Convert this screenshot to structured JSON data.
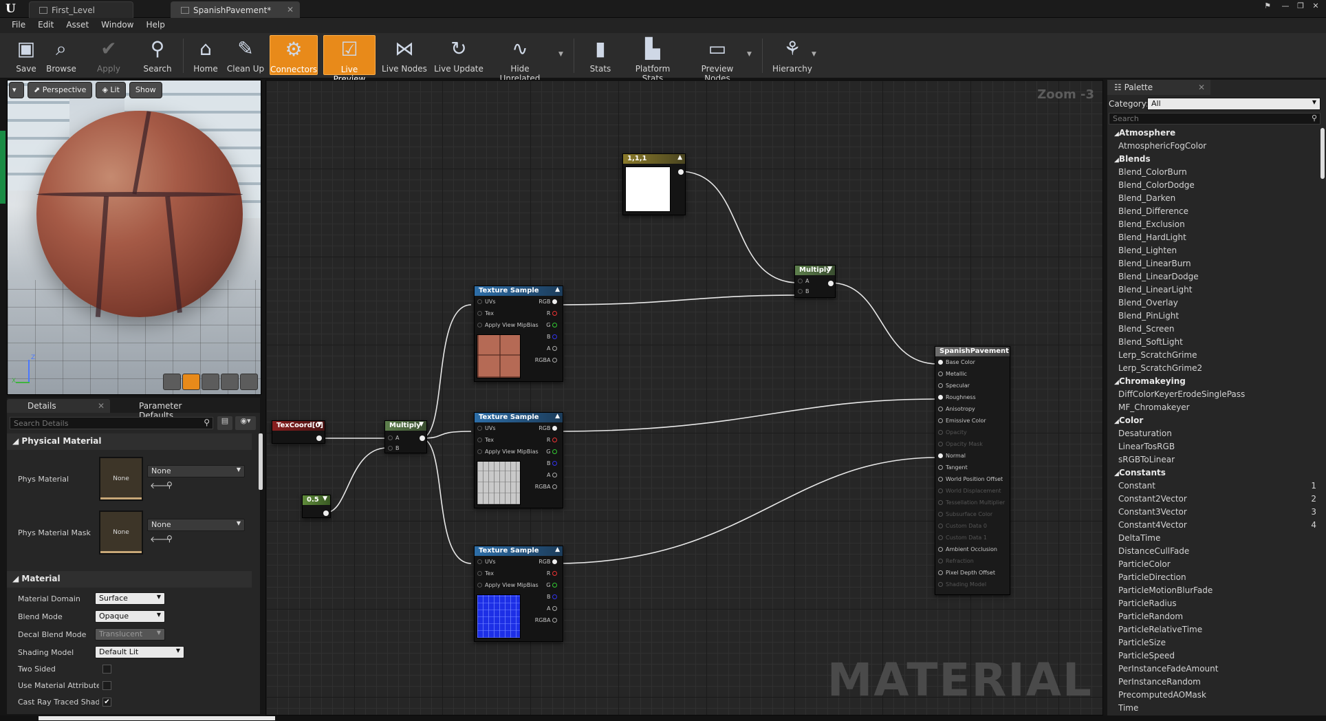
{
  "titlebar": {
    "tabs": [
      {
        "label": "First_Level"
      },
      {
        "label": "SpanishPavement*"
      }
    ]
  },
  "menu": [
    "File",
    "Edit",
    "Asset",
    "Window",
    "Help"
  ],
  "toolbar": {
    "buttons": [
      {
        "label": "Save",
        "icon": "save-icon"
      },
      {
        "label": "Browse",
        "icon": "browse-icon"
      },
      {
        "label": "Apply",
        "icon": "apply-icon",
        "disabled": true
      },
      {
        "label": "Search",
        "icon": "search-icon"
      },
      {
        "label": "Home",
        "icon": "home-icon"
      },
      {
        "label": "Clean Up",
        "icon": "cleanup-icon"
      },
      {
        "label": "Connectors",
        "icon": "connectors-icon",
        "active": true
      },
      {
        "label": "Live Preview",
        "icon": "live-preview-icon",
        "active": true
      },
      {
        "label": "Live Nodes",
        "icon": "live-nodes-icon"
      },
      {
        "label": "Live Update",
        "icon": "live-update-icon"
      },
      {
        "label": "Hide Unrelated",
        "icon": "hide-unrelated-icon"
      },
      {
        "label": "Stats",
        "icon": "stats-icon"
      },
      {
        "label": "Platform Stats",
        "icon": "platform-stats-icon"
      },
      {
        "label": "Preview Nodes",
        "icon": "preview-nodes-icon"
      },
      {
        "label": "Hierarchy",
        "icon": "hierarchy-icon"
      }
    ]
  },
  "viewport": {
    "perspective": "Perspective",
    "lit": "Lit",
    "show": "Show",
    "axis_z": "Z",
    "axis_x": "X"
  },
  "details": {
    "tabs": [
      "Details",
      "Parameter Defaults"
    ],
    "search_placeholder": "Search Details",
    "physical_material": {
      "title": "Physical Material",
      "phys_material_label": "Phys Material",
      "phys_material_value": "None",
      "phys_material_thumb": "None",
      "phys_mask_label": "Phys Material Mask",
      "phys_mask_value": "None",
      "phys_mask_thumb": "None"
    },
    "material": {
      "title": "Material",
      "rows": [
        {
          "label": "Material Domain",
          "value": "Surface"
        },
        {
          "label": "Blend Mode",
          "value": "Opaque"
        },
        {
          "label": "Decal Blend Mode",
          "value": "Translucent"
        },
        {
          "label": "Shading Model",
          "value": "Default Lit"
        },
        {
          "label": "Two Sided",
          "checked": false
        },
        {
          "label": "Use Material Attributes",
          "checked": false
        },
        {
          "label": "Cast Ray Traced Shadows",
          "checked": true
        }
      ]
    }
  },
  "graph": {
    "zoom": "Zoom -3",
    "watermark": "MATERIAL",
    "nodes": {
      "constant3": {
        "title": "1,1,1"
      },
      "multiply_top": {
        "title": "Multiply",
        "pins": [
          "A",
          "B"
        ]
      },
      "texcoord": {
        "title": "TexCoord[0]"
      },
      "multiply_mid": {
        "title": "Multiply",
        "pins": [
          "A",
          "B"
        ]
      },
      "const_half": {
        "title": "0.5"
      },
      "texture_sample": {
        "title": "Texture Sample",
        "inputs": [
          "UVs",
          "Tex",
          "Apply View MipBias"
        ],
        "outputs": [
          "RGB",
          "R",
          "G",
          "B",
          "A",
          "RGBA"
        ]
      },
      "result": {
        "title": "SpanishPavement",
        "pins": [
          {
            "label": "Base Color",
            "connected": true
          },
          {
            "label": "Metallic"
          },
          {
            "label": "Specular"
          },
          {
            "label": "Roughness",
            "connected": true
          },
          {
            "label": "Anisotropy"
          },
          {
            "label": "Emissive Color"
          },
          {
            "label": "Opacity",
            "disabled": true
          },
          {
            "label": "Opacity Mask",
            "disabled": true
          },
          {
            "label": "Normal",
            "connected": true
          },
          {
            "label": "Tangent"
          },
          {
            "label": "World Position Offset"
          },
          {
            "label": "World Displacement",
            "disabled": true
          },
          {
            "label": "Tessellation Multiplier",
            "disabled": true
          },
          {
            "label": "Subsurface Color",
            "disabled": true
          },
          {
            "label": "Custom Data 0",
            "disabled": true
          },
          {
            "label": "Custom Data 1",
            "disabled": true
          },
          {
            "label": "Ambient Occlusion"
          },
          {
            "label": "Refraction",
            "disabled": true
          },
          {
            "label": "Pixel Depth Offset"
          },
          {
            "label": "Shading Model",
            "disabled": true
          }
        ]
      }
    }
  },
  "palette": {
    "tab": "Palette",
    "category_label": "Category:",
    "category_value": "All",
    "search_placeholder": "Search",
    "items": [
      {
        "label": "Atmosphere",
        "cat": true
      },
      {
        "label": "AtmosphericFogColor"
      },
      {
        "label": "Blends",
        "cat": true
      },
      {
        "label": "Blend_ColorBurn"
      },
      {
        "label": "Blend_ColorDodge"
      },
      {
        "label": "Blend_Darken"
      },
      {
        "label": "Blend_Difference"
      },
      {
        "label": "Blend_Exclusion"
      },
      {
        "label": "Blend_HardLight"
      },
      {
        "label": "Blend_Lighten"
      },
      {
        "label": "Blend_LinearBurn"
      },
      {
        "label": "Blend_LinearDodge"
      },
      {
        "label": "Blend_LinearLight"
      },
      {
        "label": "Blend_Overlay"
      },
      {
        "label": "Blend_PinLight"
      },
      {
        "label": "Blend_Screen"
      },
      {
        "label": "Blend_SoftLight"
      },
      {
        "label": "Lerp_ScratchGrime"
      },
      {
        "label": "Lerp_ScratchGrime2"
      },
      {
        "label": "Chromakeying",
        "cat": true
      },
      {
        "label": "DiffColorKeyerErodeSinglePass"
      },
      {
        "label": "MF_Chromakeyer"
      },
      {
        "label": "Color",
        "cat": true
      },
      {
        "label": "Desaturation"
      },
      {
        "label": "LinearTosRGB"
      },
      {
        "label": "sRGBToLinear"
      },
      {
        "label": "Constants",
        "cat": true
      },
      {
        "label": "Constant",
        "hotkey": "1"
      },
      {
        "label": "Constant2Vector",
        "hotkey": "2"
      },
      {
        "label": "Constant3Vector",
        "hotkey": "3"
      },
      {
        "label": "Constant4Vector",
        "hotkey": "4"
      },
      {
        "label": "DeltaTime"
      },
      {
        "label": "DistanceCullFade"
      },
      {
        "label": "ParticleColor"
      },
      {
        "label": "ParticleDirection"
      },
      {
        "label": "ParticleMotionBlurFade"
      },
      {
        "label": "ParticleRadius"
      },
      {
        "label": "ParticleRandom"
      },
      {
        "label": "ParticleRelativeTime"
      },
      {
        "label": "ParticleSize"
      },
      {
        "label": "ParticleSpeed"
      },
      {
        "label": "PerInstanceFadeAmount"
      },
      {
        "label": "PerInstanceRandom"
      },
      {
        "label": "PrecomputedAOMask"
      },
      {
        "label": "Time"
      }
    ]
  },
  "colors": {
    "accent": "#e88a1a",
    "texture_header": "#2d6ea8",
    "multiply_header": "#5d7f4c",
    "texcoord_header": "#8a1f1f",
    "const_header": "#5e8a3a",
    "constant3_header": "#8a7a2a",
    "result_header": "#6e6e6e"
  }
}
